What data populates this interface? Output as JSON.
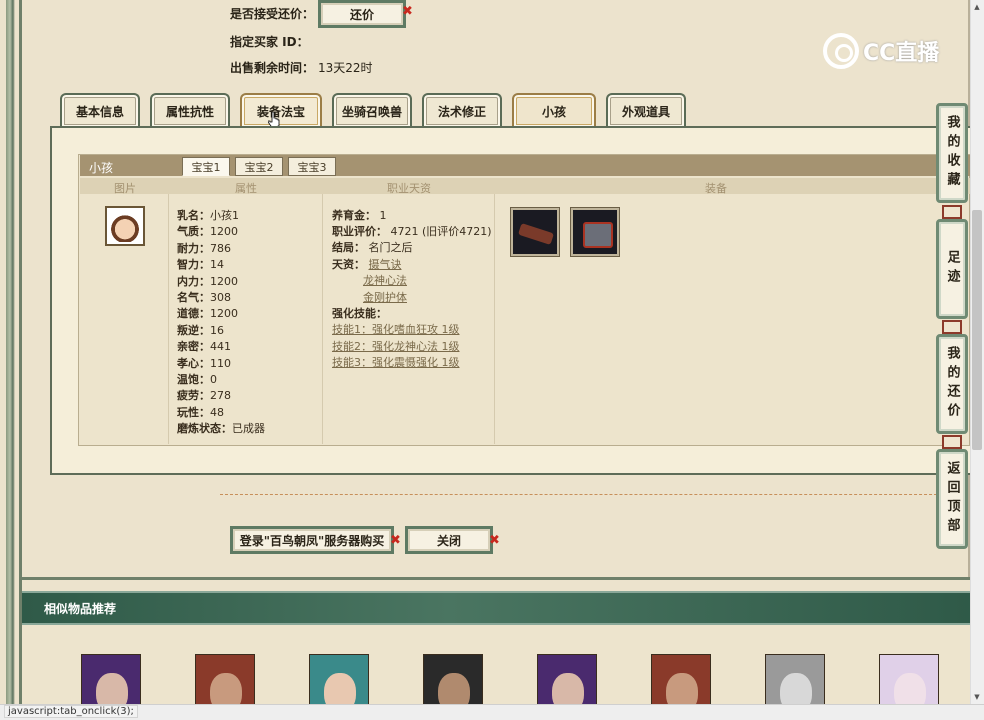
{
  "top_info": {
    "accept_counter_label": "是否接受还价：",
    "counter_button": "还价",
    "buyer_label": "指定买家 ID：",
    "remaining_label": "出售剩余时间：",
    "remaining_value": "13天22时"
  },
  "watermark": {
    "brand": "CC直播"
  },
  "main_tabs": [
    {
      "label": "基本信息"
    },
    {
      "label": "属性抗性"
    },
    {
      "label": "装备法宝"
    },
    {
      "label": "坐骑召唤兽"
    },
    {
      "label": "法术修正"
    },
    {
      "label": "小孩"
    },
    {
      "label": "外观道具"
    }
  ],
  "child_panel": {
    "title": "小孩",
    "sub_tabs": [
      "宝宝1",
      "宝宝2",
      "宝宝3"
    ],
    "columns": [
      "图片",
      "属性",
      "职业天资",
      "装备"
    ],
    "attributes": [
      {
        "k": "乳名：",
        "v": "小孩1"
      },
      {
        "k": "气质：",
        "v": "1200"
      },
      {
        "k": "耐力：",
        "v": "786"
      },
      {
        "k": "智力：",
        "v": "14"
      },
      {
        "k": "内力：",
        "v": "1200"
      },
      {
        "k": "名气：",
        "v": "308"
      },
      {
        "k": "道德：",
        "v": "1200"
      },
      {
        "k": "叛逆：",
        "v": "16"
      },
      {
        "k": "亲密：",
        "v": "441"
      },
      {
        "k": "孝心：",
        "v": "110"
      },
      {
        "k": "温饱：",
        "v": "0"
      },
      {
        "k": "疲劳：",
        "v": "278"
      },
      {
        "k": "玩性：",
        "v": "48"
      },
      {
        "k": "磨炼状态：",
        "v": "已成器"
      }
    ],
    "talent": {
      "fee_label": "养育金：",
      "fee_value": "1",
      "eval_label": "职业评价：",
      "eval_value": "4721 (旧评价4721)",
      "ending_label": "结局：",
      "ending_value": "名门之后",
      "gift_label": "天资：",
      "gifts": [
        "摄气诀",
        "龙神心法",
        "金刚护体"
      ],
      "skills_label": "强化技能：",
      "skills": [
        "技能1：强化嗜血狂攻 1级",
        "技能2：强化龙神心法 1级",
        "技能3：强化震慑强化 1级"
      ]
    },
    "equipment": [
      "equipment-slot-1",
      "equipment-slot-2"
    ]
  },
  "actions": {
    "login_buy": "登录\"百鸟朝凤\"服务器购买",
    "close": "关闭"
  },
  "side_nav": [
    {
      "label": "我的收藏"
    },
    {
      "label": "足迹"
    },
    {
      "label": "我的还价"
    },
    {
      "label": "返回顶部"
    }
  ],
  "similar": {
    "title": "相似物品推荐",
    "thumbs": [
      {
        "hair": "#4a2a6e",
        "skin": "#d8b8a8"
      },
      {
        "hair": "#8a3a2a",
        "skin": "#c89a7e"
      },
      {
        "hair": "#3a8a8a",
        "skin": "#e8c8b0"
      },
      {
        "hair": "#2a2a2a",
        "skin": "#b08a6e"
      },
      {
        "hair": "#4a2a6e",
        "skin": "#d8b8a8"
      },
      {
        "hair": "#8a3a2a",
        "skin": "#c89a7e"
      },
      {
        "hair": "#9a9a9a",
        "skin": "#d8d8d8"
      },
      {
        "hair": "#e0d0e8",
        "skin": "#f0e0e8"
      }
    ]
  },
  "status_bar": {
    "text": "javascript:tab_onclick(3);"
  }
}
